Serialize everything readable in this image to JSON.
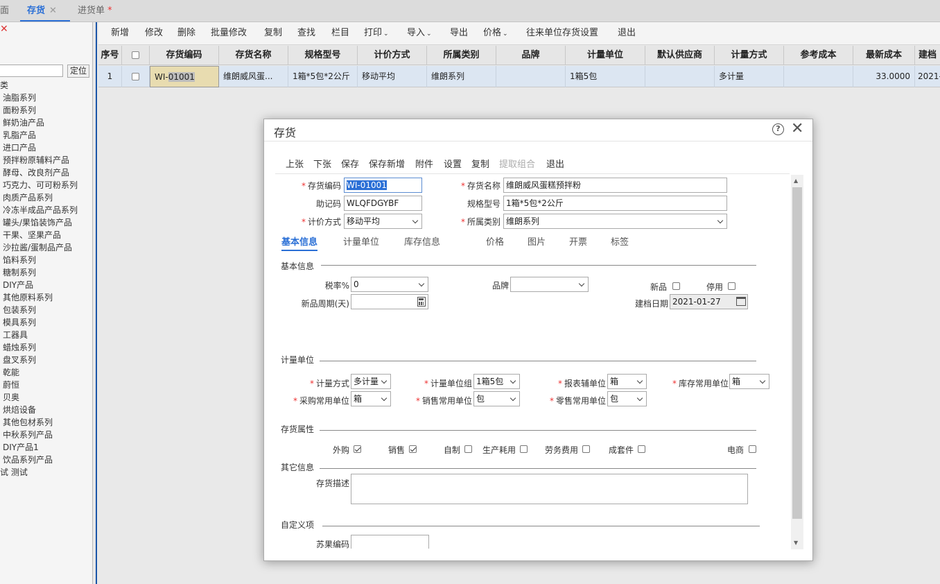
{
  "tabs": [
    {
      "label": "面"
    },
    {
      "label": "存货",
      "close": "✕"
    },
    {
      "label": "进货单",
      "star": "*"
    }
  ],
  "left": {
    "close_icon": "✕",
    "locate_label": "定位",
    "tree": [
      "类",
      "油脂系列",
      "面粉系列",
      "鲜奶油产品",
      "乳脂产品",
      "进口产品",
      "预拌粉原辅料产品",
      "酵母、改良剂产品",
      "巧克力、可可粉系列",
      "肉质产品系列",
      "冷冻半成品产品系列",
      "罐头/果馅装饰产品",
      "干果、坚果产品",
      "沙拉酱/蛋制品产品",
      "馅料系列",
      "糖制系列",
      "DIY产品",
      "其他原料系列",
      "包装系列",
      "模具系列",
      "工器具",
      "蜡烛系列",
      "盘叉系列",
      "乾能",
      "蔚恒",
      "贝奥",
      "烘焙设备",
      "其他包材系列",
      "中秋系列产品",
      "DIY产品1",
      "饮品系列产品",
      "试 测试"
    ]
  },
  "toolbar": [
    "新增",
    "修改",
    "删除",
    "批量修改",
    "复制",
    "查找",
    "栏目",
    "打印",
    "导入",
    "导出",
    "价格",
    "往来单位存货设置",
    "退出"
  ],
  "toolbar_caret": "⌄",
  "grid": {
    "headers": [
      "序号",
      "",
      "存货编码",
      "存货名称",
      "规格型号",
      "计价方式",
      "所属类别",
      "品牌",
      "计量单位",
      "默认供应商",
      "计量方式",
      "参考成本",
      "最新成本",
      "建档"
    ],
    "row": {
      "seq": "1",
      "code_prefix": "WI-",
      "code_sel": "01001",
      "name": "维朗威风蛋...",
      "spec": "1箱*5包*2公斤",
      "pricing": "移动平均",
      "category": "维朗系列",
      "brand": "",
      "unit": "1箱5包",
      "supplier": "",
      "measure": "多计量",
      "ref_cost": "",
      "latest_cost": "33.0000",
      "created": "2021-"
    }
  },
  "dialog": {
    "title": "存货",
    "help": "?",
    "close": "✕",
    "toolbar": [
      "上张",
      "下张",
      "保存",
      "保存新增",
      "附件",
      "设置",
      "复制",
      "提取组合",
      "退出"
    ],
    "fields": {
      "code_label": "存货编码",
      "code": "WI-01001",
      "name_label": "存货名称",
      "name": "维朗威风蛋糕预拌粉",
      "mnemonic_label": "助记码",
      "mnemonic": "WLQFDGYBF",
      "spec_label": "规格型号",
      "spec": "1箱*5包*2公斤",
      "pricing_label": "计价方式",
      "pricing": "移动平均",
      "category_label": "所属类别",
      "category": "维朗系列",
      "req": "*"
    },
    "tabs": [
      "基本信息",
      "计量单位",
      "库存信息",
      "价格",
      "图片",
      "开票",
      "标签"
    ],
    "basic": {
      "section": "基本信息",
      "tax_label": "税率%",
      "tax": "0",
      "brand_label": "品牌",
      "brand": "",
      "new_label": "新品",
      "stop_label": "停用",
      "new_period_label": "新品周期(天)",
      "new_period": "",
      "created_label": "建档日期",
      "created": "2021-01-27"
    },
    "units": {
      "section": "计量单位",
      "measure_label": "计量方式",
      "measure": "多计量",
      "group_label": "计量单位组",
      "group": "1箱5包",
      "report_label": "报表辅单位",
      "report": "箱",
      "stock_label": "库存常用单位",
      "stock": "箱",
      "purchase_label": "采购常用单位",
      "purchase": "箱",
      "sales_label": "销售常用单位",
      "sales": "包",
      "retail_label": "零售常用单位",
      "retail": "包"
    },
    "attrs": {
      "section": "存货属性",
      "items": [
        {
          "label": "外购",
          "checked": true
        },
        {
          "label": "销售",
          "checked": true
        },
        {
          "label": "自制",
          "checked": false
        },
        {
          "label": "生产耗用",
          "checked": false
        },
        {
          "label": "劳务费用",
          "checked": false
        },
        {
          "label": "成套件",
          "checked": false
        },
        {
          "label": "电商",
          "checked": false
        }
      ]
    },
    "other": {
      "section": "其它信息",
      "desc_label": "存货描述"
    },
    "custom": {
      "section": "自定义项",
      "apple_label": "苏果编码"
    }
  }
}
